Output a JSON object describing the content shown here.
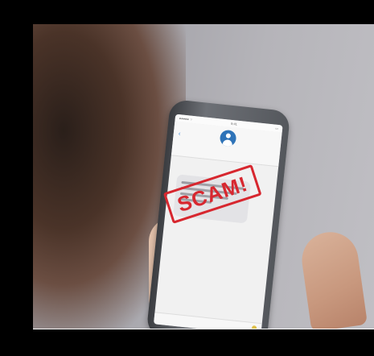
{
  "photo": {
    "description_icon": "smartphone-scam-warning-photo",
    "stamp_text": "SCAM!",
    "stamp_color": "#d7272f"
  },
  "phone_screen": {
    "status_left": "●●●●● ⌔",
    "status_center": "9:41",
    "status_right": "▭",
    "back_label": "‹"
  }
}
